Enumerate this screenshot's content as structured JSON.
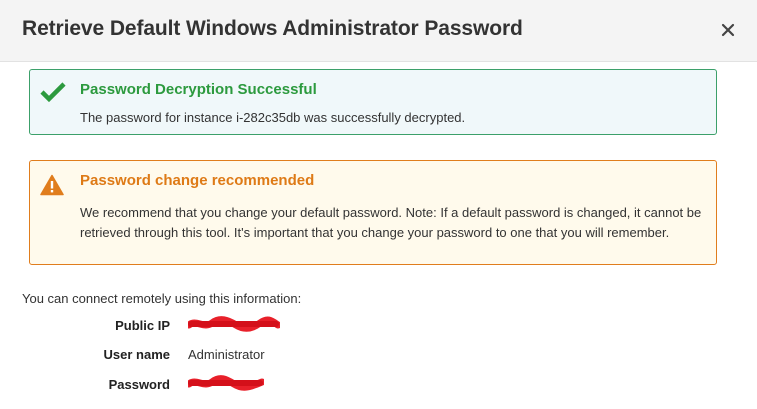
{
  "dialog": {
    "title": "Retrieve Default Windows Administrator Password",
    "close_icon": "close-icon"
  },
  "success_alert": {
    "icon": "checkmark-icon",
    "color": "#2c9a3e",
    "title": "Password Decryption Successful",
    "message": "The password for instance i-282c35db was successfully decrypted."
  },
  "warning_alert": {
    "icon": "warning-triangle-icon",
    "color": "#de7a16",
    "title": "Password change recommended",
    "message": "We recommend that you change your default password. Note: If a default password is changed, it cannot be retrieved through this tool. It's important that you change your password to one that you will remember."
  },
  "connection": {
    "intro": "You can connect remotely using this information:",
    "public_ip": {
      "label": "Public IP",
      "value": ""
    },
    "user_name": {
      "label": "User name",
      "value": "Administrator"
    },
    "password": {
      "label": "Password",
      "value": ""
    }
  }
}
